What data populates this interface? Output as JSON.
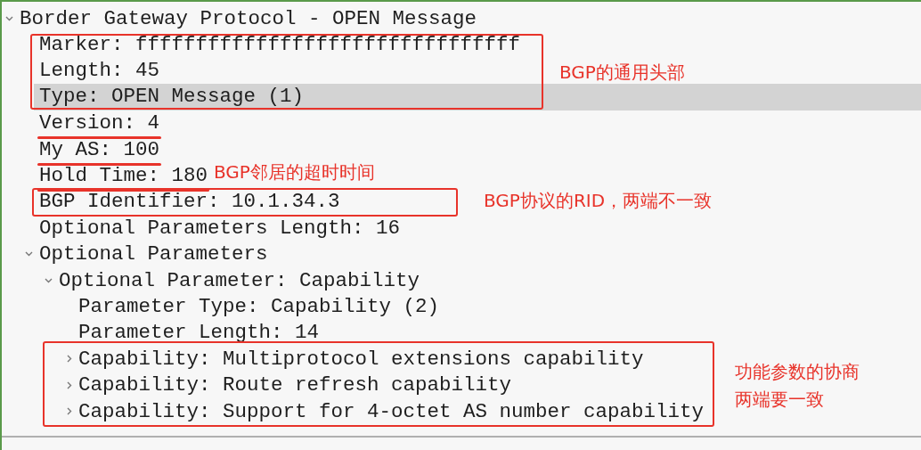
{
  "tree": [
    {
      "label": "Border Gateway Protocol - OPEN Message",
      "expanded": true,
      "selected": false,
      "underlined": false,
      "children": [
        {
          "label": "Marker: ffffffffffffffffffffffffffffffff",
          "selected": false,
          "underlined": false
        },
        {
          "label": "Length: 45",
          "selected": false,
          "underlined": false
        },
        {
          "label": "Type: OPEN Message (1)",
          "selected": true,
          "underlined": false
        },
        {
          "label": "Version: 4",
          "selected": false,
          "underlined": true
        },
        {
          "label": "My AS: 100",
          "selected": false,
          "underlined": true
        },
        {
          "label": "Hold Time: 180",
          "selected": false,
          "underlined": true
        },
        {
          "label": "BGP Identifier: 10.1.34.3",
          "selected": false,
          "underlined": false
        },
        {
          "label": "Optional Parameters Length: 16",
          "selected": false,
          "underlined": false
        },
        {
          "label": "Optional Parameters",
          "expanded": true,
          "selected": false,
          "underlined": false,
          "children": [
            {
              "label": "Optional Parameter: Capability",
              "expanded": true,
              "selected": false,
              "underlined": false,
              "children": [
                {
                  "label": "Parameter Type: Capability (2)",
                  "selected": false,
                  "underlined": false
                },
                {
                  "label": "Parameter Length: 14",
                  "selected": false,
                  "underlined": false
                },
                {
                  "label": "Capability: Multiprotocol extensions capability",
                  "expanded": false,
                  "selected": false,
                  "underlined": false
                },
                {
                  "label": "Capability: Route refresh capability",
                  "expanded": false,
                  "selected": false,
                  "underlined": false
                },
                {
                  "label": "Capability: Support for 4-octet AS number capability",
                  "expanded": false,
                  "selected": false,
                  "underlined": false
                }
              ]
            }
          ]
        }
      ]
    }
  ],
  "annotations": [
    {
      "kind": "box"
    },
    {
      "kind": "label",
      "text": "BGP的通用头部"
    },
    {
      "kind": "label",
      "text": "BGP邻居的超时时间"
    },
    {
      "kind": "box"
    },
    {
      "kind": "label",
      "text": "BGP协议的RID，两端不一致"
    },
    {
      "kind": "box"
    },
    {
      "kind": "label",
      "text": "功能参数的协商"
    },
    {
      "kind": "label",
      "text": "两端要一致"
    }
  ]
}
